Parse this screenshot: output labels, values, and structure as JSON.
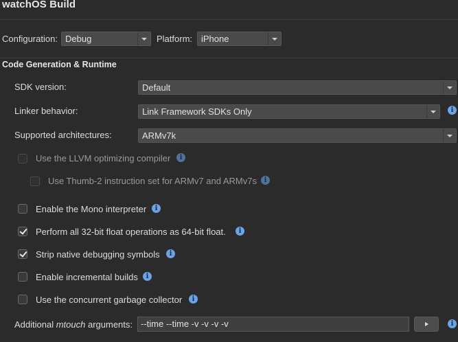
{
  "header": {
    "title": "watchOS Build"
  },
  "config": {
    "configuration_label": "Configuration:",
    "configuration_value": "Debug",
    "platform_label": "Platform:",
    "platform_value": "iPhone"
  },
  "section": {
    "title": "Code Generation & Runtime"
  },
  "fields": {
    "sdk_version": {
      "label": "SDK version:",
      "value": "Default"
    },
    "linker_behavior": {
      "label": "Linker behavior:",
      "value": "Link Framework SDKs Only"
    },
    "supported_architectures": {
      "label": "Supported architectures:",
      "value": "ARMv7k"
    }
  },
  "checkboxes": {
    "llvm": {
      "label": "Use the LLVM optimizing compiler",
      "checked": false,
      "enabled": false
    },
    "thumb2": {
      "label": "Use Thumb-2 instruction set for ARMv7 and ARMv7s",
      "checked": false,
      "enabled": false
    },
    "mono_interpreter": {
      "label": "Enable the Mono interpreter",
      "checked": false,
      "enabled": true
    },
    "float64": {
      "label": "Perform all 32-bit float operations as 64-bit float.",
      "checked": true,
      "enabled": true
    },
    "strip_symbols": {
      "label": "Strip native debugging symbols",
      "checked": true,
      "enabled": true
    },
    "incremental_builds": {
      "label": "Enable incremental builds",
      "checked": false,
      "enabled": true
    },
    "concurrent_gc": {
      "label": "Use the concurrent garbage collector",
      "checked": false,
      "enabled": true
    }
  },
  "mtouch": {
    "label_prefix": "Additional ",
    "label_emph": "mtouch",
    "label_suffix": " arguments:",
    "value": "--time --time -v -v -v -v"
  },
  "icons": {
    "info": "info-icon",
    "dropdown": "chevron-down-icon",
    "run": "play-icon"
  },
  "colors": {
    "background": "#2b2b2b",
    "info_icon": "#6aa3e6",
    "control": "#4a4a4a"
  }
}
